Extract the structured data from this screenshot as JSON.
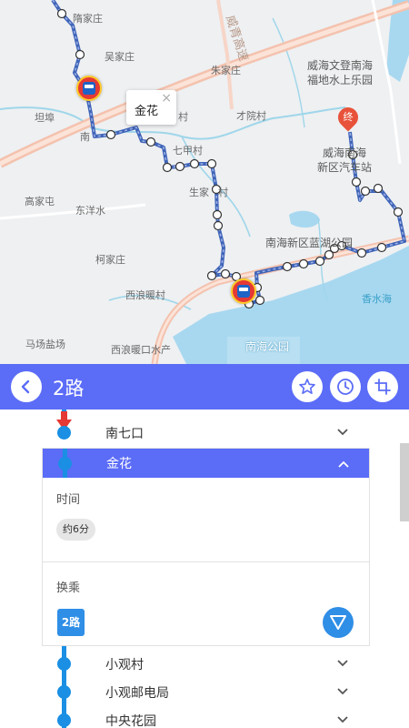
{
  "map": {
    "labels": {
      "l1": "隋家庄",
      "l2": "吴家庄",
      "l3": "朱家庄",
      "l4": "威海文登南海",
      "l5": "福地水上乐园",
      "l6": "坦埠",
      "l7": "南",
      "l8": "村",
      "l9": "才院村",
      "l10": "七甲村",
      "l11": "威海南海",
      "l12": "新区汽车站",
      "l13": "高家屯",
      "l14": "东洋水",
      "l15": "生家",
      "l16": "村",
      "l17": "南海新区蓝湖公园",
      "l18": "柯家庄",
      "l19": "西浪暖村",
      "l20": "香水海",
      "l21": "马场盐场",
      "l22": "西浪暖口水产",
      "l23": "南海公园",
      "l24": "威青高速"
    },
    "popup_text": "金花",
    "popup_close": "×",
    "end_marker": "终"
  },
  "header": {
    "title": "2路"
  },
  "stops": {
    "s1": "南七口",
    "s2": "金花",
    "s3": "小观村",
    "s4": "小观邮电局",
    "s5": "中央花园"
  },
  "detail": {
    "time_label": "时间",
    "time_value": "约6分",
    "transfer_label": "换乘",
    "transfer_route": "2路"
  },
  "colors": {
    "accent": "#5b6cf7",
    "track": "#1a8fe3",
    "route_line": "#3f64b8",
    "button": "#2f8ee6"
  }
}
